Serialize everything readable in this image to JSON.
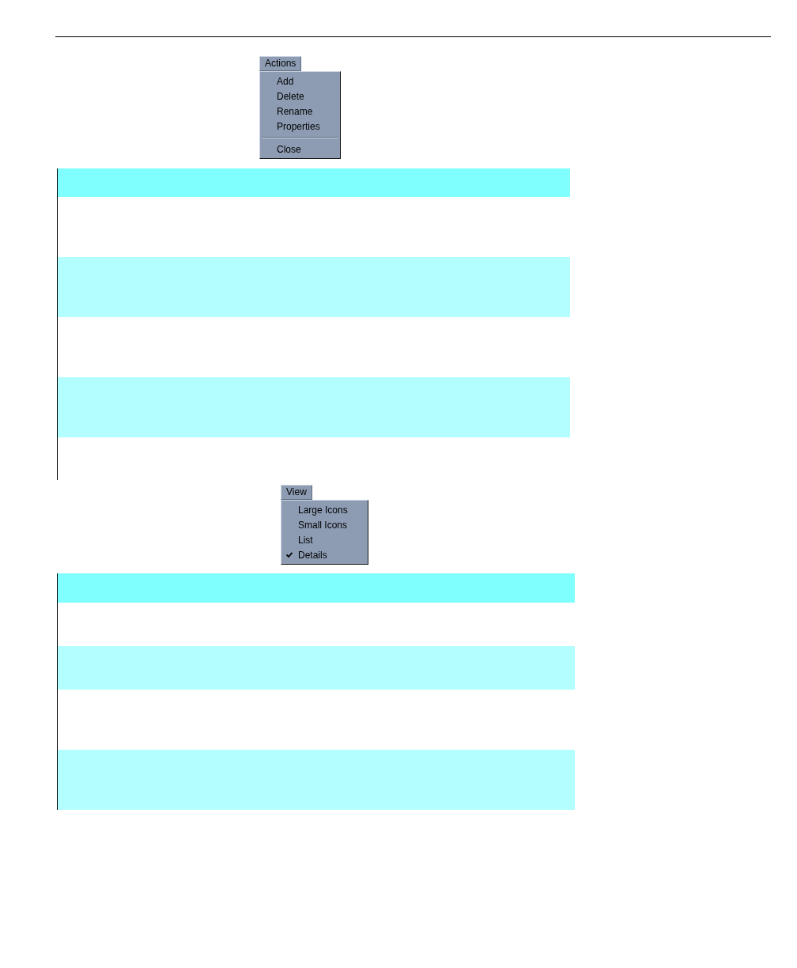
{
  "figures": [
    {
      "menu": {
        "title": "Actions",
        "items": [
          {
            "kind": "command",
            "label": "Add"
          },
          {
            "kind": "command",
            "label": "Delete"
          },
          {
            "kind": "command",
            "label": "Rename"
          },
          {
            "kind": "command",
            "label": "Properties"
          },
          {
            "kind": "separator"
          },
          {
            "kind": "command",
            "label": "Close"
          }
        ]
      },
      "table": {
        "rows": [
          {
            "kind": "header"
          },
          {
            "kind": "plain"
          },
          {
            "kind": "shaded"
          },
          {
            "kind": "plain"
          },
          {
            "kind": "shaded"
          },
          {
            "kind": "plain"
          }
        ]
      }
    },
    {
      "menu": {
        "title": "View",
        "items": [
          {
            "kind": "command",
            "label": "Large Icons",
            "checked": false
          },
          {
            "kind": "command",
            "label": "Small Icons",
            "checked": false
          },
          {
            "kind": "command",
            "label": "List",
            "checked": false
          },
          {
            "kind": "command",
            "label": "Details",
            "checked": true
          }
        ]
      },
      "table": {
        "rows": [
          {
            "kind": "header"
          },
          {
            "kind": "plain"
          },
          {
            "kind": "shaded"
          },
          {
            "kind": "plain"
          },
          {
            "kind": "shaded"
          }
        ]
      }
    }
  ]
}
